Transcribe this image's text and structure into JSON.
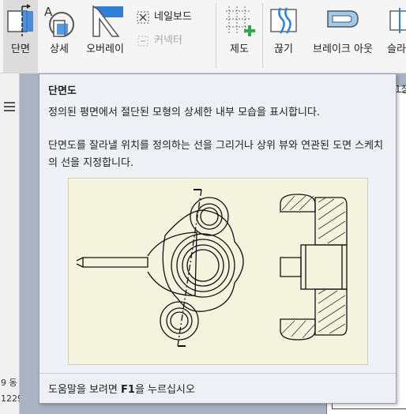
{
  "ribbon": {
    "section_view": "단면",
    "detail": "상세",
    "overlay": "오버레이",
    "nailboard": "네일보드",
    "connector": "커넥터",
    "draft": "제도",
    "break_out": "끊기",
    "break_view": "브레이크 아웃",
    "slice": "슬라"
  },
  "tooltip": {
    "title": "단면도",
    "description_1": "정의된 평면에서 절단된 모형의 상세한 내부 모습을 표시합니다.",
    "description_2": "단면도를 잘라낼 위치를 정의하는 선을 그리거나 상위 뷰와 연관된 도면 스케치의 선을 지정합니다.",
    "help_prefix": "도움말을 보려면 ",
    "help_key": "F1",
    "help_suffix": "을 누르십시오"
  },
  "edge_text": {
    "right_fragment": "1정",
    "status_left_1": "9 동",
    "status_left_2": "1229"
  },
  "colors": {
    "accent_blue": "#2f7fd8",
    "green_add": "#2ea84a",
    "figure_bg": "#f4f4de",
    "tooltip_bg": "#eef0f6",
    "canvas_bg": "#a9b3c2"
  }
}
